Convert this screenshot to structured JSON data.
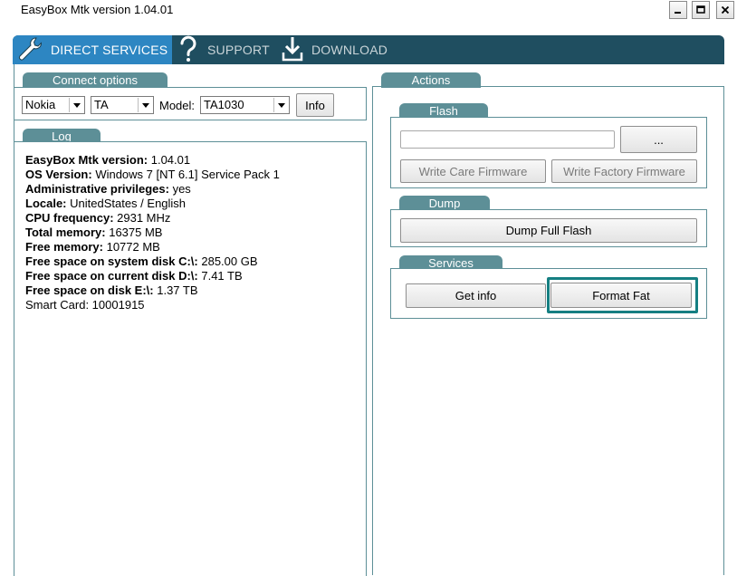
{
  "window": {
    "title": "EasyBox Mtk version 1.04.01",
    "minimize": "_",
    "maximize": "□",
    "close": "✕"
  },
  "tabs": [
    {
      "label": "DIRECT SERVICES",
      "icon": "wrench-icon",
      "active": true
    },
    {
      "label": "SUPPORT",
      "icon": "question-icon",
      "active": false
    },
    {
      "label": "DOWNLOAD",
      "icon": "download-icon",
      "active": false
    }
  ],
  "connect": {
    "title": "Connect options",
    "brand": "Nokia",
    "type": "TA",
    "model_label": "Model:",
    "model": "TA1030",
    "info_button": "Info"
  },
  "log": {
    "title": "Log",
    "lines": [
      {
        "key": "EasyBox Mtk version:",
        "value": " 1.04.01"
      },
      {
        "key": "OS Version:",
        "value": " Windows 7 [NT 6.1] Service Pack 1"
      },
      {
        "key": "Administrative privileges:",
        "value": " yes"
      },
      {
        "key": "Locale:",
        "value": " UnitedStates / English"
      },
      {
        "key": "CPU frequency:",
        "value": " 2931 MHz"
      },
      {
        "key": "Total memory:",
        "value": " 16375 MB"
      },
      {
        "key": "Free memory:",
        "value": " 10772 MB"
      },
      {
        "key": "Free space on system disk C:\\:",
        "value": " 285.00 GB"
      },
      {
        "key": "Free space on current disk D:\\:",
        "value": " 7.41 TB"
      },
      {
        "key": "Free space on disk E:\\:",
        "value": " 1.37 TB"
      },
      {
        "key": "",
        "value": "Smart Card: 10001915"
      }
    ]
  },
  "actions": {
    "title": "Actions",
    "flash": {
      "title": "Flash",
      "path_value": "",
      "browse_button": "...",
      "write_care": "Write Care Firmware",
      "write_factory": "Write Factory Firmware"
    },
    "dump": {
      "title": "Dump",
      "dump_full": "Dump Full Flash"
    },
    "services": {
      "title": "Services",
      "get_info": "Get info",
      "format_fat": "Format Fat"
    }
  },
  "colors": {
    "tabbar": "#1f4e60",
    "active_tab": "#2d86c2",
    "panel_header": "#5d8f97",
    "focus": "#157f82"
  }
}
